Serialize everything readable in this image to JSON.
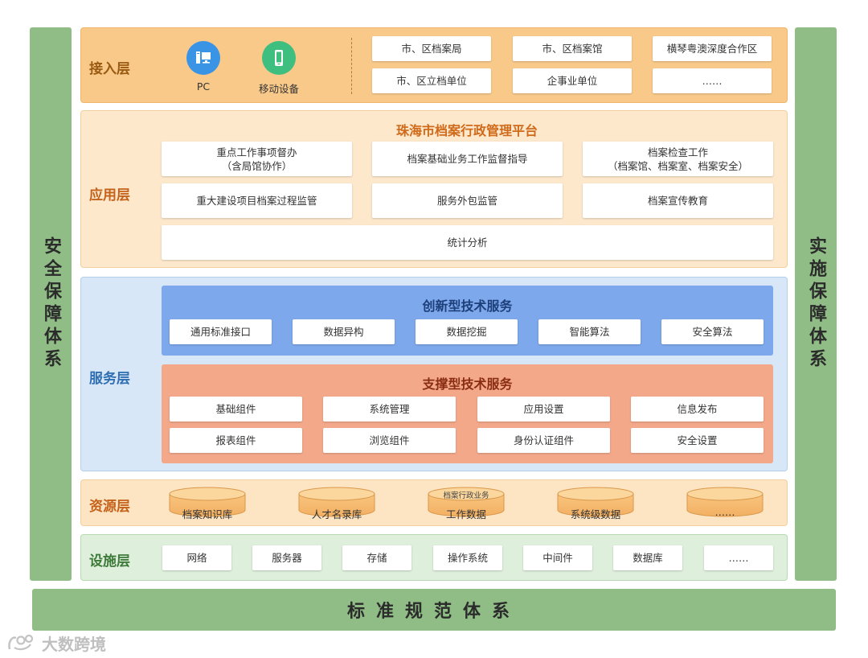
{
  "side_left": "安全保障体系",
  "side_right": "实施保障体系",
  "bottom_bar": "标准规范体系",
  "access_layer": {
    "name": "接入层",
    "devices": [
      {
        "label": "PC",
        "icon": "pc-icon",
        "color": "#3a94e6"
      },
      {
        "label": "移动设备",
        "icon": "mobile-icon",
        "color": "#3fbf7f"
      }
    ],
    "units": [
      "市、区档案局",
      "市、区档案馆",
      "横琴粤澳深度合作区",
      "市、区立档单位",
      "企事业单位",
      "……"
    ]
  },
  "app_layer": {
    "name": "应用层",
    "title": "珠海市档案行政管理平台",
    "items": [
      {
        "line1": "重点工作事项督办",
        "line2": "（含局馆协作）"
      },
      {
        "line1": "档案基础业务工作监督指导",
        "line2": ""
      },
      {
        "line1": "档案检查工作",
        "line2": "（档案馆、档案室、档案安全）"
      },
      {
        "line1": "重大建设项目档案过程监管",
        "line2": ""
      },
      {
        "line1": "服务外包监管",
        "line2": ""
      },
      {
        "line1": "档案宣传教育",
        "line2": ""
      }
    ],
    "bottom_item": "统计分析"
  },
  "service_layer": {
    "name": "服务层",
    "innovative": {
      "title": "创新型技术服务",
      "items": [
        "通用标准接口",
        "数据异构",
        "数据挖掘",
        "智能算法",
        "安全算法"
      ]
    },
    "support": {
      "title": "支撑型技术服务",
      "items": [
        "基础组件",
        "系统管理",
        "应用设置",
        "信息发布",
        "报表组件",
        "浏览组件",
        "身份认证组件",
        "安全设置"
      ]
    }
  },
  "resource_layer": {
    "name": "资源层",
    "items": [
      {
        "top": "",
        "label": "档案知识库"
      },
      {
        "top": "",
        "label": "人才名录库"
      },
      {
        "top": "档案行政业务",
        "label": "工作数据"
      },
      {
        "top": "",
        "label": "系统级数据"
      },
      {
        "top": "",
        "label": "……"
      }
    ]
  },
  "infra_layer": {
    "name": "设施层",
    "items": [
      "网络",
      "服务器",
      "存储",
      "操作系统",
      "中间件",
      "数据库",
      "……"
    ]
  },
  "watermark": "大数跨境",
  "colors": {
    "side_green": "#8fbd85",
    "access_bg": "#f9c98a",
    "app_bg": "#fde8cc",
    "service_bg": "#d7e7f8",
    "innovative_bg": "#7ea8ec",
    "support_bg": "#f3a88a",
    "resource_bg": "#fde5c4",
    "infra_bg": "#deefdb"
  }
}
